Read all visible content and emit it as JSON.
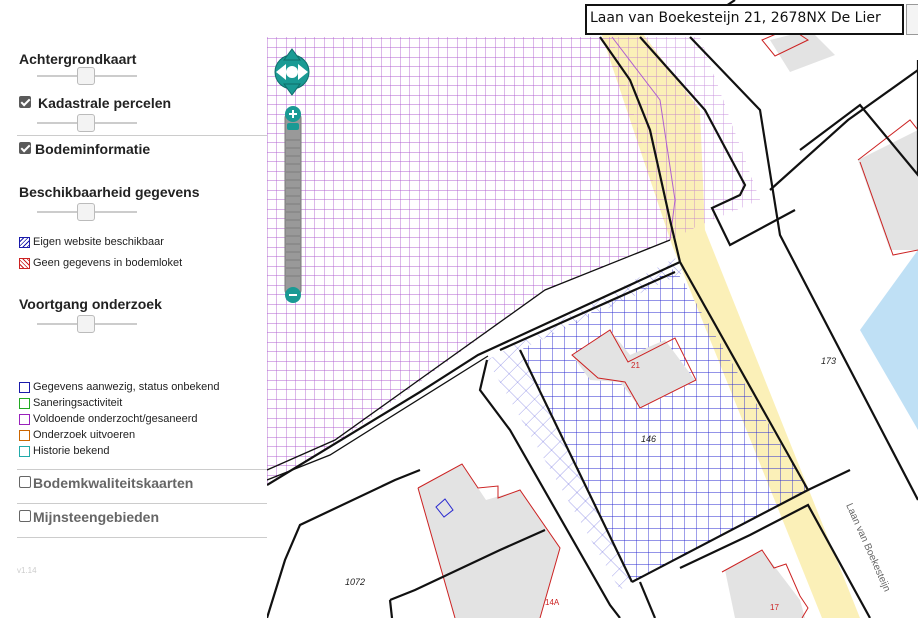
{
  "search": {
    "value": "Laan van Boekesteijn 21, 2678NX De Lier"
  },
  "sidebar": {
    "achtergrond": {
      "label": "Achtergrondkaart"
    },
    "kadastraal": {
      "label": "Kadastrale percelen",
      "checked": true
    },
    "bodem": {
      "label": "Bodeminformatie",
      "checked": true
    },
    "beschikbaarheid": {
      "label": "Beschikbaarheid gegevens"
    },
    "beschik_legend": [
      {
        "label": "Eigen website beschikbaar",
        "color": "#1a1aaa"
      },
      {
        "label": "Geen gegevens in bodemloket",
        "color": "#cc2222"
      }
    ],
    "voortgang": {
      "label": "Voortgang onderzoek"
    },
    "voortgang_legend": [
      {
        "label": "Gegevens aanwezig, status onbekend",
        "color": "#1a1aaa"
      },
      {
        "label": "Saneringsactiviteit",
        "color": "#22aa22"
      },
      {
        "label": "Voldoende onderzocht/gesaneerd",
        "color": "#9922bb"
      },
      {
        "label": "Onderzoek uitvoeren",
        "color": "#cc6600"
      },
      {
        "label": "Historie bekend",
        "color": "#22aaaa"
      }
    ],
    "kwaliteit": {
      "label": "Bodemkwaliteitskaarten",
      "checked": false
    },
    "mijnsteen": {
      "label": "Mijnsteengebieden",
      "checked": false
    },
    "version": "v1.14"
  },
  "map": {
    "labels": {
      "parcel_173": "173",
      "parcel_146": "146",
      "parcel_1072": "1072",
      "house_21": "21",
      "house_14a": "14A",
      "house_17": "17",
      "street": "Laan van Boekesteijn"
    },
    "colors": {
      "purple_grid": "#b060d0",
      "blue_grid": "#2a2ad0",
      "parcel_red": "#cc2222",
      "road_yellow": "#fbf0b8",
      "water": "#bfe0f5",
      "building": "#e3e3e3",
      "nav_teal": "#1a9a94"
    },
    "icons": [
      "pan-up-icon",
      "pan-down-icon",
      "pan-left-icon",
      "pan-right-icon",
      "zoom-in-icon",
      "zoom-out-icon"
    ]
  }
}
